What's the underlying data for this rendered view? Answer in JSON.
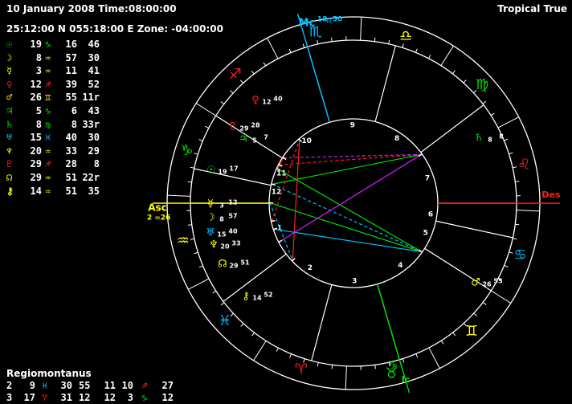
{
  "header": {
    "date_time": "10 January 2008 Time:08:00:00",
    "location": "25:12:00 N 055:18:00 E Zone: -04:00:00",
    "mode": "Tropical True"
  },
  "colors": {
    "background": "#000000",
    "fire": "#ff2020",
    "earth": "#00e000",
    "air": "#ffff00",
    "water": "#00c0ff",
    "white": "#ffffff",
    "magenta": "#d020ff"
  },
  "planets": [
    {
      "glyph": "☉",
      "deg": "19",
      "sign": "♑",
      "min": "16",
      "sec": "46",
      "color": "#00e000",
      "sign_color": "#00e000",
      "r": ""
    },
    {
      "glyph": "☽",
      "deg": "8",
      "sign": "♒",
      "min": "57",
      "sec": "30",
      "color": "#ffff00",
      "sign_color": "#ffff00",
      "r": ""
    },
    {
      "glyph": "☿",
      "deg": "3",
      "sign": "♒",
      "min": "11",
      "sec": "41",
      "color": "#ffff00",
      "sign_color": "#ffff00",
      "r": ""
    },
    {
      "glyph": "♀",
      "deg": "12",
      "sign": "♐",
      "min": "39",
      "sec": "52",
      "color": "#ff2020",
      "sign_color": "#ff2020",
      "r": ""
    },
    {
      "glyph": "♂",
      "deg": "26",
      "sign": "♊",
      "min": "55",
      "sec": "11r",
      "color": "#ffff00",
      "sign_color": "#ffff00",
      "r": "r"
    },
    {
      "glyph": "♃",
      "deg": "5",
      "sign": "♑",
      "min": "6",
      "sec": "43",
      "color": "#00e000",
      "sign_color": "#00e000",
      "r": ""
    },
    {
      "glyph": "♄",
      "deg": "8",
      "sign": "♍",
      "min": "8",
      "sec": "33r",
      "color": "#00e000",
      "sign_color": "#00e000",
      "r": "r"
    },
    {
      "glyph": "♅",
      "deg": "15",
      "sign": "♓",
      "min": "40",
      "sec": "30",
      "color": "#00c0ff",
      "sign_color": "#00c0ff",
      "r": ""
    },
    {
      "glyph": "♆",
      "deg": "20",
      "sign": "♒",
      "min": "33",
      "sec": "29",
      "color": "#ffff00",
      "sign_color": "#ffff00",
      "r": ""
    },
    {
      "glyph": "♇",
      "deg": "29",
      "sign": "♐",
      "min": "28",
      "sec": "8",
      "color": "#ff2020",
      "sign_color": "#ff2020",
      "r": ""
    },
    {
      "glyph": "☊",
      "deg": "29",
      "sign": "♒",
      "min": "51",
      "sec": "22r",
      "color": "#ffff00",
      "sign_color": "#ffff00",
      "r": "r"
    },
    {
      "glyph": "⚷",
      "deg": "14",
      "sign": "♒",
      "min": "51",
      "sec": "35",
      "color": "#ffff00",
      "sign_color": "#ffff00",
      "r": ""
    }
  ],
  "house_system": "Regiomontanus",
  "house_cusps": [
    {
      "house": "2",
      "deg": "9",
      "sign": "♓",
      "min": "30",
      "sign_color": "#00c0ff"
    },
    {
      "house": "3",
      "deg": "17",
      "sign": "♈",
      "min": "31",
      "sign_color": "#ff2020"
    },
    {
      "house": "11",
      "deg": "10",
      "sign": "♐",
      "min": "27",
      "sign_color": "#ff2020"
    },
    {
      "house": "12",
      "deg": "3",
      "sign": "♑",
      "min": "12",
      "sign_color": "#00e000"
    }
  ],
  "house_row_extra": {
    "row1_mid": "55",
    "row2_mid": "12"
  },
  "wheel": {
    "asc_label": "Asc",
    "asc_deg": "2",
    "asc_sign": "♒",
    "asc_min": "26",
    "mc_label": "Mc",
    "mc_deg": "18",
    "mc_sign": "♏",
    "mc_min": "50",
    "des_label": "Des",
    "ic_label": "Ic",
    "house_numbers": [
      "1",
      "2",
      "3",
      "4",
      "5",
      "6",
      "7",
      "8",
      "9",
      "10",
      "11",
      "12"
    ],
    "zodiac": [
      {
        "glyph": "♒",
        "color": "#ffff00"
      },
      {
        "glyph": "♓",
        "color": "#00c0ff"
      },
      {
        "glyph": "♈",
        "color": "#ff2020"
      },
      {
        "glyph": "♉",
        "color": "#00e000"
      },
      {
        "glyph": "♊",
        "color": "#ffff00"
      },
      {
        "glyph": "♋",
        "color": "#00c0ff"
      },
      {
        "glyph": "♌",
        "color": "#ff2020"
      },
      {
        "glyph": "♍",
        "color": "#00e000"
      },
      {
        "glyph": "♎",
        "color": "#ffff00"
      },
      {
        "glyph": "♏",
        "color": "#00c0ff"
      },
      {
        "glyph": "♐",
        "color": "#ff2020"
      },
      {
        "glyph": "♑",
        "color": "#00e000"
      }
    ],
    "planet_labels": [
      {
        "glyph": "☉",
        "deg": "19",
        "min": "17",
        "color": "#00e000"
      },
      {
        "glyph": "♃",
        "deg": "5",
        "min": "7",
        "color": "#00e000"
      },
      {
        "glyph": "♇",
        "deg": "29",
        "min": "28",
        "color": "#ff2020"
      },
      {
        "glyph": "♀",
        "deg": "12",
        "min": "40",
        "color": "#ff2020"
      },
      {
        "glyph": "♄",
        "deg": "8",
        "min": "8",
        "color": "#00e000"
      },
      {
        "glyph": "☿",
        "deg": "3",
        "min": "12",
        "color": "#ffff00"
      },
      {
        "glyph": "☽",
        "deg": "8",
        "min": "57",
        "color": "#ffff00"
      },
      {
        "glyph": "⚷",
        "deg": "14",
        "min": "52",
        "color": "#ffff00"
      },
      {
        "glyph": "♆",
        "deg": "20",
        "min": "33",
        "color": "#ffff00"
      },
      {
        "glyph": "☊",
        "deg": "29",
        "min": "51",
        "color": "#ffff00"
      },
      {
        "glyph": "♅",
        "deg": "15",
        "min": "40",
        "color": "#00c0ff"
      },
      {
        "glyph": "♂",
        "deg": "26",
        "min": "55",
        "color": "#ffff00"
      }
    ]
  }
}
